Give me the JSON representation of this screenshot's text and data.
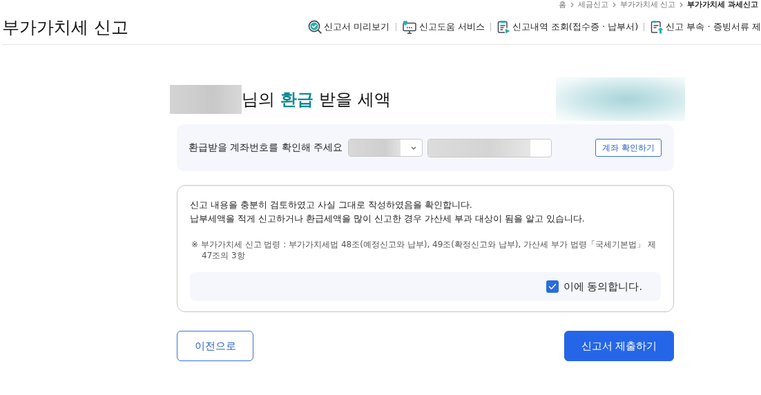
{
  "breadcrumb": [
    {
      "label": "홈",
      "current": false
    },
    {
      "label": "세금신고",
      "current": false
    },
    {
      "label": "부가가치세 신고",
      "current": false
    },
    {
      "label": "부가가치세 과세신고",
      "current": true
    }
  ],
  "header": {
    "title": "부가가치세 신고",
    "nav": [
      {
        "label": "신고서 미리보기"
      },
      {
        "label": "신고도움 서비스"
      },
      {
        "label": "신고내역 조회(접수증 · 납부서)"
      },
      {
        "label": "신고 부속 · 증빙서류 제"
      }
    ]
  },
  "refund": {
    "heading": [
      {
        "text": "님의",
        "highlight": false
      },
      {
        "text": "환급",
        "highlight": true
      },
      {
        "text": "받을 세액",
        "highlight": false
      }
    ]
  },
  "account": {
    "label": "환급받을 계좌번호를 확인해 주세요",
    "button": "계좌 확인하기"
  },
  "agreement": {
    "statements": [
      "신고 내용을 충분히 검토하였고 사실 그대로 작성하였음을 확인합니다.",
      "납부세액을 적게 신고하거나 환급세액을 많이 신고한 경우 가산세 부과 대상이 됨을 알고 있습니다."
    ],
    "note": "※ 부가가치세 신고 법령 : 부가가치세법 48조(예정신고와 납부), 49조(확정신고와 납부), 가산세 부가 법령「국세기본법」 제47조의 3항",
    "consent": {
      "label": "이에 동의합니다.",
      "checked": true
    }
  },
  "buttons": [
    {
      "label": "이전으로",
      "kind": "secondary"
    },
    {
      "label": "신고서 제출하기",
      "kind": "primary"
    }
  ]
}
